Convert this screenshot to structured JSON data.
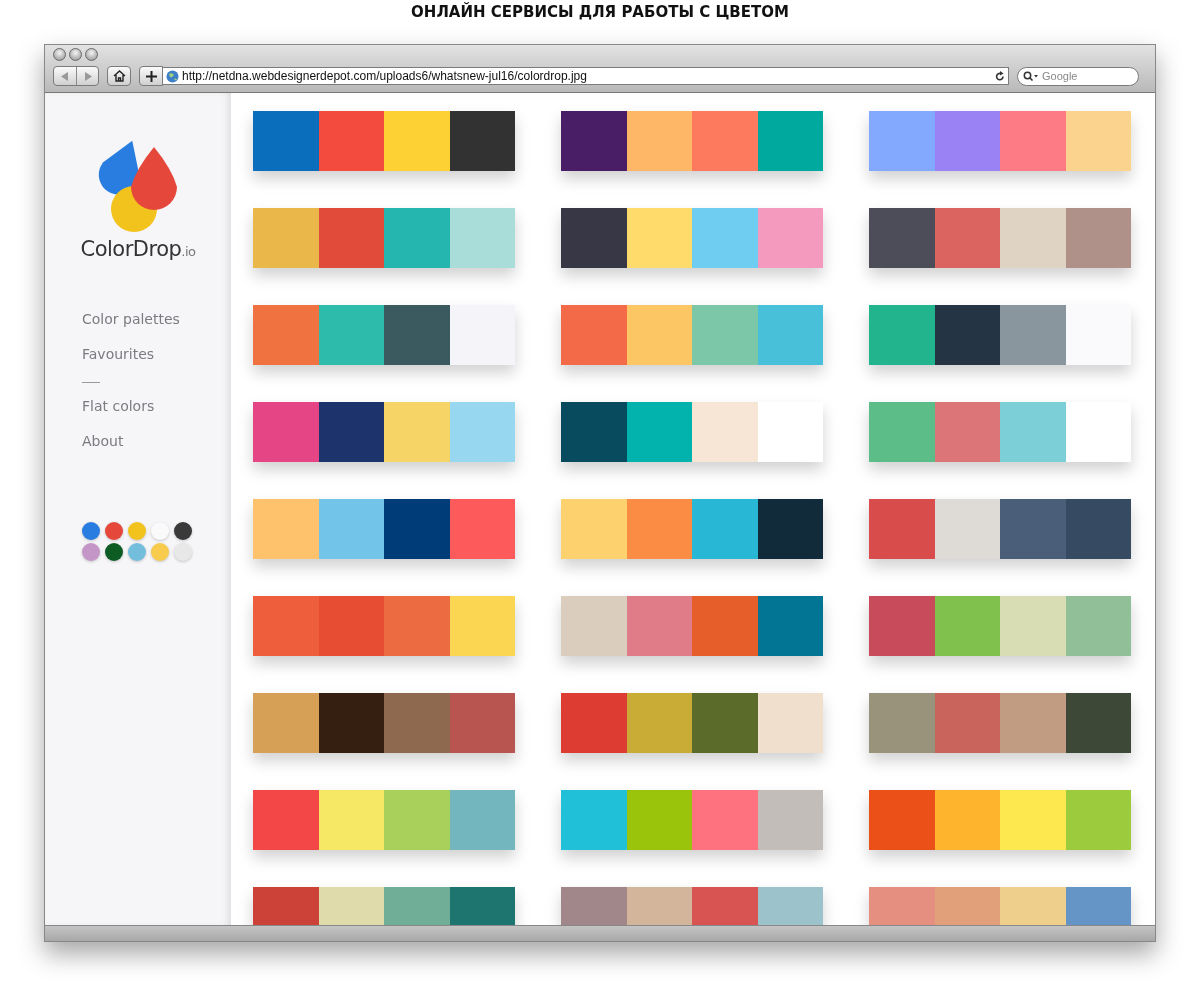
{
  "heading": "ОНЛАЙН СЕРВИСЫ ДЛЯ РАБОТЫ С ЦВЕТОМ",
  "browser": {
    "url": "http://netdna.webdesignerdepot.com/uploads6/whatsnew-jul16/colordrop.jpg",
    "search_placeholder": "Google"
  },
  "sidebar": {
    "logo_text": "ColorDrop",
    "logo_suffix": ".io",
    "nav": [
      {
        "kind": "link",
        "label": "Color palettes"
      },
      {
        "kind": "link",
        "label": "Favourites"
      },
      {
        "kind": "separator"
      },
      {
        "kind": "link",
        "label": "Flat colors"
      },
      {
        "kind": "link",
        "label": "About"
      }
    ],
    "color_filters": [
      {
        "color": "#2a7de0"
      },
      {
        "color": "#e5483a"
      },
      {
        "color": "#f2c31c"
      },
      {
        "color": "#fafafa"
      },
      {
        "color": "#3a3a3a"
      },
      {
        "color": "#c496c8"
      },
      {
        "color": "#0c5c23"
      },
      {
        "color": "#74bedd"
      },
      {
        "color": "#f7cb4b"
      },
      {
        "color": "#e8e8e8"
      }
    ]
  },
  "palettes": [
    {
      "swatches": [
        {
          "color": "#0a6ebd"
        },
        {
          "color": "#f44b3f"
        },
        {
          "color": "#fdd033"
        },
        {
          "color": "#323232"
        }
      ]
    },
    {
      "swatches": [
        {
          "color": "#4a1e66"
        },
        {
          "color": "#feb766"
        },
        {
          "color": "#fe7a5f"
        },
        {
          "color": "#00a99d"
        }
      ]
    },
    {
      "swatches": [
        {
          "color": "#82a9fd"
        },
        {
          "color": "#9a82f5"
        },
        {
          "color": "#fd7b84"
        },
        {
          "color": "#fcd38e"
        }
      ]
    },
    {
      "swatches": [
        {
          "color": "#eab84a"
        },
        {
          "color": "#e04b3a"
        },
        {
          "color": "#25b6b0"
        },
        {
          "color": "#a9ddd9"
        }
      ]
    },
    {
      "swatches": [
        {
          "color": "#383745"
        },
        {
          "color": "#fedb6b"
        },
        {
          "color": "#6fcdf1"
        },
        {
          "color": "#f49abf"
        }
      ]
    },
    {
      "swatches": [
        {
          "color": "#4d4c59"
        },
        {
          "color": "#dc6460"
        },
        {
          "color": "#dfd3c3"
        },
        {
          "color": "#b0918a"
        }
      ]
    },
    {
      "swatches": [
        {
          "color": "#f07241"
        },
        {
          "color": "#2dbbab"
        },
        {
          "color": "#3a5a60"
        },
        {
          "color": "#f5f5f9"
        }
      ]
    },
    {
      "swatches": [
        {
          "color": "#f26a48"
        },
        {
          "color": "#fdc664"
        },
        {
          "color": "#7cc7a8"
        },
        {
          "color": "#49c0d9"
        }
      ]
    },
    {
      "swatches": [
        {
          "color": "#22b48c"
        },
        {
          "color": "#243444"
        },
        {
          "color": "#8a969e"
        },
        {
          "color": "#fafafc"
        }
      ]
    },
    {
      "swatches": [
        {
          "color": "#e54584"
        },
        {
          "color": "#1d336b"
        },
        {
          "color": "#f6d465"
        },
        {
          "color": "#98d7f0"
        }
      ]
    },
    {
      "swatches": [
        {
          "color": "#094b5e"
        },
        {
          "color": "#02b3ad"
        },
        {
          "color": "#f7e6d6"
        },
        {
          "color": "#ffffff"
        }
      ]
    },
    {
      "swatches": [
        {
          "color": "#5cbd88"
        },
        {
          "color": "#db7577"
        },
        {
          "color": "#7ccfd6"
        },
        {
          "color": "#ffffff"
        }
      ]
    },
    {
      "swatches": [
        {
          "color": "#fec26c"
        },
        {
          "color": "#72c4e8"
        },
        {
          "color": "#003d78"
        },
        {
          "color": "#fd5b5b"
        }
      ]
    },
    {
      "swatches": [
        {
          "color": "#fdd16e"
        },
        {
          "color": "#fa8c44"
        },
        {
          "color": "#28b8d6"
        },
        {
          "color": "#122b3b"
        }
      ]
    },
    {
      "swatches": [
        {
          "color": "#d84c4c"
        },
        {
          "color": "#dedbd7"
        },
        {
          "color": "#4a5e7a"
        },
        {
          "color": "#364a62"
        }
      ]
    },
    {
      "swatches": [
        {
          "color": "#ee5d3c"
        },
        {
          "color": "#e64d32"
        },
        {
          "color": "#ec6b41"
        },
        {
          "color": "#fad653"
        }
      ]
    },
    {
      "swatches": [
        {
          "color": "#dbcdbd"
        },
        {
          "color": "#e07b88"
        },
        {
          "color": "#e65e2a"
        },
        {
          "color": "#037594"
        }
      ]
    },
    {
      "swatches": [
        {
          "color": "#c84b5b"
        },
        {
          "color": "#80c14e"
        },
        {
          "color": "#d9ddb3"
        },
        {
          "color": "#91bf98"
        }
      ]
    },
    {
      "swatches": [
        {
          "color": "#d6a056"
        },
        {
          "color": "#341f10"
        },
        {
          "color": "#8f6850"
        },
        {
          "color": "#b85551"
        }
      ]
    },
    {
      "swatches": [
        {
          "color": "#dd3c33"
        },
        {
          "color": "#c8ac36"
        },
        {
          "color": "#5b6b2a"
        },
        {
          "color": "#f1dfcd"
        }
      ]
    },
    {
      "swatches": [
        {
          "color": "#98937a"
        },
        {
          "color": "#c9645d"
        },
        {
          "color": "#c19c82"
        },
        {
          "color": "#3e4837"
        }
      ]
    },
    {
      "swatches": [
        {
          "color": "#f34747"
        },
        {
          "color": "#f6e865"
        },
        {
          "color": "#a9d05a"
        },
        {
          "color": "#74b6bd"
        }
      ]
    },
    {
      "swatches": [
        {
          "color": "#20c0d9"
        },
        {
          "color": "#9ac40c"
        },
        {
          "color": "#fe717f"
        },
        {
          "color": "#c2bdb8"
        }
      ]
    },
    {
      "swatches": [
        {
          "color": "#ec5019"
        },
        {
          "color": "#feb52d"
        },
        {
          "color": "#fde84f"
        },
        {
          "color": "#9ccb3e"
        }
      ]
    },
    {
      "swatches": [
        {
          "color": "#cc4238"
        },
        {
          "color": "#e0dbaa"
        },
        {
          "color": "#70ae97"
        },
        {
          "color": "#1e7570"
        }
      ]
    },
    {
      "swatches": [
        {
          "color": "#a1868a"
        },
        {
          "color": "#d3b59c"
        },
        {
          "color": "#d75452"
        },
        {
          "color": "#9cc3cb"
        }
      ]
    },
    {
      "swatches": [
        {
          "color": "#e58f80"
        },
        {
          "color": "#e2a07a"
        },
        {
          "color": "#efcf8c"
        },
        {
          "color": "#6594c6"
        }
      ]
    }
  ]
}
